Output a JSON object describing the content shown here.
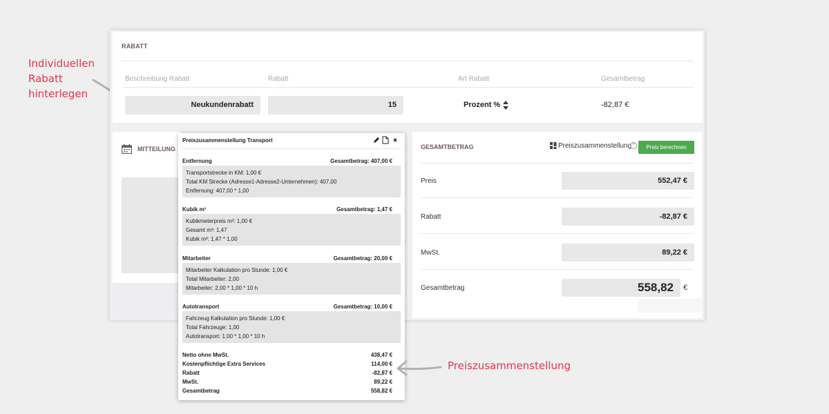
{
  "annotations": {
    "left_lines": [
      "Individuellen",
      "Rabatt",
      "hinterlegen"
    ],
    "right": "Preiszusammenstellung"
  },
  "rabatt": {
    "title": "RABATT",
    "headers": [
      "Beschreibung Rabatt",
      "Rabatt",
      "Art Rabatt",
      "Gesamtbetrag"
    ],
    "beschreibung": "Neukundenrabatt",
    "rabatt": "15",
    "art": "Prozent %",
    "gesamtbetrag": "-82,87 €"
  },
  "mitteilung": {
    "title": "MITTEILUNG"
  },
  "gesamt": {
    "title": "GESAMTBETRAG",
    "ps_label": "Preiszusammenstellung",
    "help": "?",
    "button": "Preis berechnen",
    "rows": [
      {
        "label": "Preis",
        "value": "552,47 €"
      },
      {
        "label": "Rabatt",
        "value": "-82,87 €"
      },
      {
        "label": "MwSt.",
        "value": "89,22 €"
      }
    ],
    "total_label": "Gesamtbetrag",
    "total_value": "558,82",
    "currency": "€"
  },
  "popup": {
    "title": "Preiszusammenstellung Transport",
    "sections": [
      {
        "name": "Entfernung",
        "total": "Gesamtbetrag: 407,00 €",
        "lines": [
          "Transportstrecke in KM: 1,00 €",
          "Total KM Strecke (Adresse1-Adresse2-Unternehmen): 407,00",
          "Entfernung: 407,00 * 1,00"
        ]
      },
      {
        "name": "Kubik m³",
        "total": "Gesamtbetrag: 1,47 €",
        "lines": [
          "Kubikmeterpreis m³: 1,00 €",
          "Gesamt m³: 1,47",
          "Kubik m³: 1,47 * 1,00"
        ]
      },
      {
        "name": "Mitarbeiter",
        "total": "Gesamtbetrag: 20,00 €",
        "lines": [
          "Mitarbeiter Kalkulation pro Stunde: 1,00 €",
          "Total Mitarbeiter: 2,00",
          "Mitarbeiter: 2,00 * 1,00 * 10 h"
        ]
      },
      {
        "name": "Autotransport",
        "total": "Gesamtbetrag: 10,00 €",
        "lines": [
          "Fahrzeug Kalkulation pro Stunde: 1,00 €",
          "Total Fahrzeuge: 1,00",
          "Autotransport: 1,00 * 1,00 * 10 h"
        ]
      }
    ],
    "summary": [
      {
        "label": "Netto ohne MwSt.",
        "value": "438,47 €"
      },
      {
        "label": "Kostenpflichtige Extra Services",
        "value": "114,00 €"
      },
      {
        "label": "Rabatt",
        "value": "-82,87 €"
      },
      {
        "label": "MwSt.",
        "value": "89,22 €"
      },
      {
        "label": "Gesamtbetrag",
        "value": "558,82 €"
      }
    ]
  },
  "colors": {
    "accent_green": "#4caa4f",
    "annotation_red": "#e0354b",
    "field_gray": "#e8e8e8"
  },
  "icons": [
    "calendar-icon",
    "sort-icon",
    "grid-icon",
    "help-icon",
    "edit-icon",
    "document-icon",
    "close-icon",
    "arrow-icon"
  ]
}
